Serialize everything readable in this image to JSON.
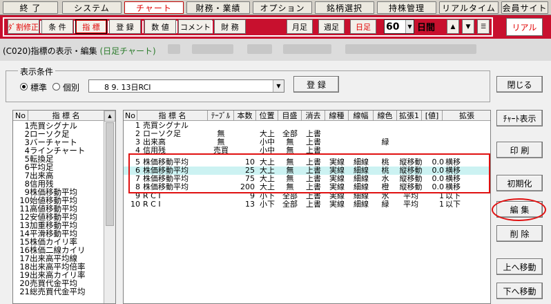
{
  "menu": [
    {
      "label": "終 了",
      "active": false
    },
    {
      "label": "システム",
      "active": false
    },
    {
      "label": "チャート",
      "active": true
    },
    {
      "label": "財務・業績",
      "active": false
    },
    {
      "label": "オプション",
      "active": false
    },
    {
      "label": "銘柄選択",
      "active": false
    },
    {
      "label": "持株管理",
      "active": false
    },
    {
      "label": "リアルタイム",
      "active": false
    },
    {
      "label": "会員サイト",
      "active": false
    }
  ],
  "toolbar": {
    "buttons": [
      {
        "label": "ﾀﾞ割修正",
        "red": true
      },
      {
        "label": "条 件",
        "red": false
      },
      {
        "label": "指 標",
        "red": true,
        "selected": true
      },
      {
        "label": "登 録",
        "red": false
      },
      {
        "label": "数 値",
        "red": false
      },
      {
        "label": "コメント",
        "red": false
      },
      {
        "label": "財 務",
        "red": false
      }
    ],
    "period_buttons": [
      {
        "label": "月足",
        "red": false
      },
      {
        "label": "週足",
        "red": false
      },
      {
        "label": "日足",
        "red": true
      }
    ],
    "count_value": "60",
    "count_unit": "日間",
    "nav": [
      "▲",
      "▼",
      "☰"
    ],
    "real_label": "リアル"
  },
  "title": {
    "prefix": "(C020)指標の表示・編集",
    "sub": "(日足チャート)"
  },
  "condition": {
    "legend": "表示条件",
    "radio_standard": "標準",
    "radio_individual": "個別",
    "selected": "standard",
    "combo_value": "8 9. 13日RCI",
    "register_button": "登 録"
  },
  "left_list": {
    "col_no": "No",
    "col_name": "指 標 名",
    "items": [
      {
        "no": "1",
        "name": "売買シグナル"
      },
      {
        "no": "2",
        "name": "ローソク足"
      },
      {
        "no": "3",
        "name": "バーチャート"
      },
      {
        "no": "4",
        "name": "ラインチャート"
      },
      {
        "no": "5",
        "name": "転換足"
      },
      {
        "no": "6",
        "name": "平均足"
      },
      {
        "no": "7",
        "name": "出来高"
      },
      {
        "no": "8",
        "name": "信用残"
      },
      {
        "no": "9",
        "name": "株価移動平均"
      },
      {
        "no": "10",
        "name": "始値移動平均"
      },
      {
        "no": "11",
        "name": "高値移動平均"
      },
      {
        "no": "12",
        "name": "安値移動平均"
      },
      {
        "no": "13",
        "name": "加重移動平均"
      },
      {
        "no": "14",
        "name": "平滑移動平均"
      },
      {
        "no": "15",
        "name": "株価カイリ率"
      },
      {
        "no": "16",
        "name": "株価二線カイリ"
      },
      {
        "no": "17",
        "name": "出来高平均線"
      },
      {
        "no": "18",
        "name": "出来高平均倍率"
      },
      {
        "no": "19",
        "name": "出来高カイリ率"
      },
      {
        "no": "20",
        "name": "売買代金平均"
      },
      {
        "no": "21",
        "name": "総売買代金平均"
      }
    ]
  },
  "grid": {
    "headers": [
      "No",
      "指 標 名",
      "ﾃｰﾌﾞﾙ",
      "本数",
      "位置",
      "目盛",
      "消去",
      "線種",
      "線幅",
      "線色",
      "拡張1",
      "[値]",
      "拡張"
    ],
    "rows": [
      {
        "no": "1",
        "name": "売買シグナル",
        "table": "",
        "count": "",
        "pos": "",
        "scale": "",
        "erase": "",
        "ltype": "",
        "lwidth": "",
        "lcolor": "",
        "ext1": "",
        "val": "",
        "ext2": "",
        "hl": false
      },
      {
        "no": "2",
        "name": "ローソク足",
        "table": "無",
        "count": "",
        "pos": "大上",
        "scale": "全部",
        "erase": "上書",
        "ltype": "",
        "lwidth": "",
        "lcolor": "",
        "ext1": "",
        "val": "",
        "ext2": "",
        "hl": false
      },
      {
        "no": "3",
        "name": "出来高",
        "table": "無",
        "count": "",
        "pos": "小中",
        "scale": "無",
        "erase": "上書",
        "ltype": "",
        "lwidth": "",
        "lcolor": "緑",
        "ext1": "",
        "val": "",
        "ext2": "",
        "hl": false
      },
      {
        "no": "4",
        "name": "信用残",
        "table": "売買",
        "count": "",
        "pos": "小中",
        "scale": "無",
        "erase": "上書",
        "ltype": "",
        "lwidth": "",
        "lcolor": "",
        "ext1": "",
        "val": "",
        "ext2": "",
        "hl": false
      },
      {
        "no": "5",
        "name": "株価移動平均",
        "table": "",
        "count": "10",
        "pos": "大上",
        "scale": "無",
        "erase": "上書",
        "ltype": "実線",
        "lwidth": "細線",
        "lcolor": "桃",
        "ext1": "縦移動",
        "val": "0.0",
        "ext2": "横移",
        "hl": false
      },
      {
        "no": "6",
        "name": "株価移動平均",
        "table": "",
        "count": "25",
        "pos": "大上",
        "scale": "無",
        "erase": "上書",
        "ltype": "実線",
        "lwidth": "細線",
        "lcolor": "桃",
        "ext1": "縦移動",
        "val": "0.0",
        "ext2": "横移",
        "hl": true
      },
      {
        "no": "7",
        "name": "株価移動平均",
        "table": "",
        "count": "75",
        "pos": "大上",
        "scale": "無",
        "erase": "上書",
        "ltype": "実線",
        "lwidth": "細線",
        "lcolor": "水",
        "ext1": "縦移動",
        "val": "0.0",
        "ext2": "横移",
        "hl": false
      },
      {
        "no": "8",
        "name": "株価移動平均",
        "table": "",
        "count": "200",
        "pos": "大上",
        "scale": "無",
        "erase": "上書",
        "ltype": "実線",
        "lwidth": "細線",
        "lcolor": "橙",
        "ext1": "縦移動",
        "val": "0.0",
        "ext2": "横移",
        "hl": false
      },
      {
        "no": "9",
        "name": "R C I",
        "table": "",
        "count": "9",
        "pos": "小下",
        "scale": "全部",
        "erase": "上書",
        "ltype": "実線",
        "lwidth": "細線",
        "lcolor": "水",
        "ext1": "平均",
        "val": "1",
        "ext2": "以下",
        "hl": false
      },
      {
        "no": "10",
        "name": "R C I",
        "table": "",
        "count": "13",
        "pos": "小下",
        "scale": "全部",
        "erase": "上書",
        "ltype": "実線",
        "lwidth": "細線",
        "lcolor": "緑",
        "ext1": "平均",
        "val": "1",
        "ext2": "以下",
        "hl": false
      }
    ]
  },
  "side_buttons": {
    "close": "閉じる",
    "chart_display": "ﾁｬｰﾄ表示",
    "print": "印 刷",
    "init": "初期化",
    "edit": "編 集",
    "delete": "削 除",
    "move_up": "上へ移動",
    "move_down": "下へ移動"
  }
}
